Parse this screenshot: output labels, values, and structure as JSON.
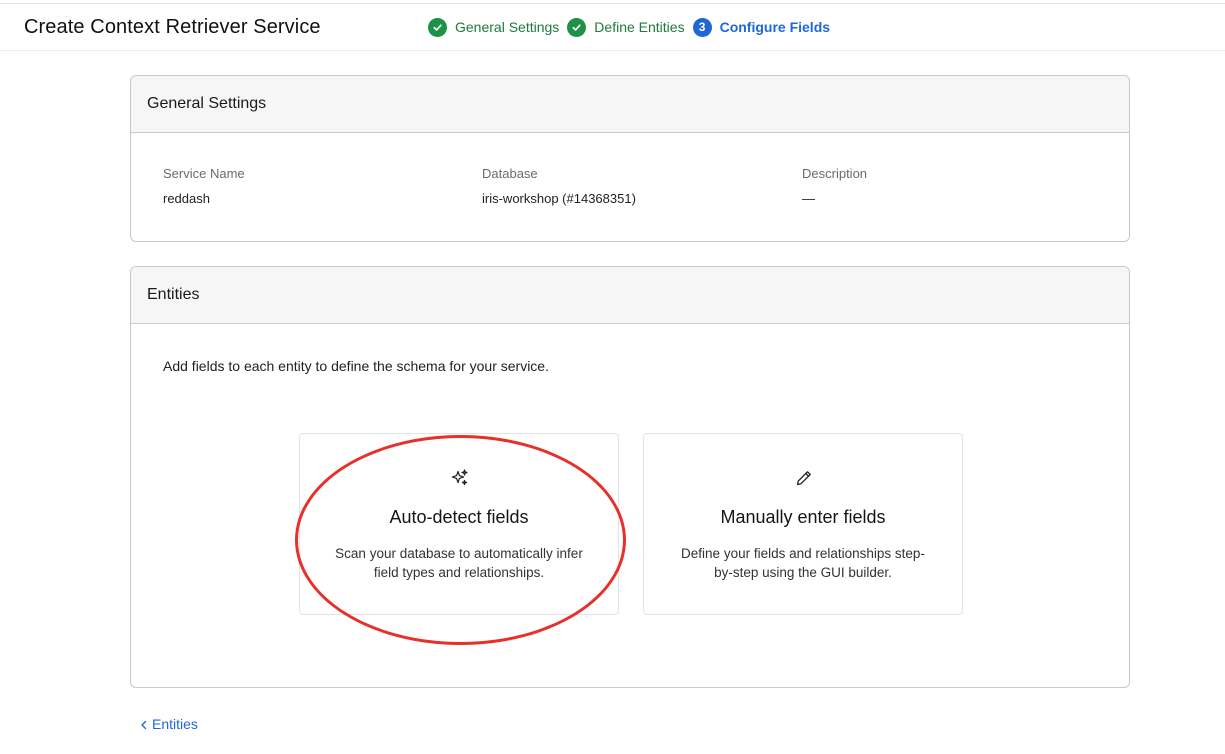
{
  "header": {
    "title": "Create Context Retriever Service"
  },
  "stepper": {
    "steps": [
      {
        "label": "General Settings",
        "state": "done"
      },
      {
        "label": "Define Entities",
        "state": "done"
      },
      {
        "label": "Configure Fields",
        "state": "current",
        "number": "3"
      }
    ],
    "colors": {
      "done": "#1e9146",
      "current": "#1f67d8"
    }
  },
  "general_settings": {
    "heading": "General Settings",
    "fields": [
      {
        "label": "Service Name",
        "value": "reddash"
      },
      {
        "label": "Database",
        "value": "iris-workshop (#14368351)"
      },
      {
        "label": "Description",
        "value": "—"
      }
    ]
  },
  "entities": {
    "heading": "Entities",
    "description": "Add fields to each entity to define the schema for your service.",
    "options": [
      {
        "icon": "sparkles-icon",
        "title": "Auto-detect fields",
        "description": "Scan your database to automatically infer field types and relationships."
      },
      {
        "icon": "pencil-icon",
        "title": "Manually enter fields",
        "description": "Define your fields and relationships step-by-step using the GUI builder."
      }
    ]
  },
  "footer": {
    "back_label": "Entities"
  },
  "annotation": {
    "color": "#e8302a"
  }
}
